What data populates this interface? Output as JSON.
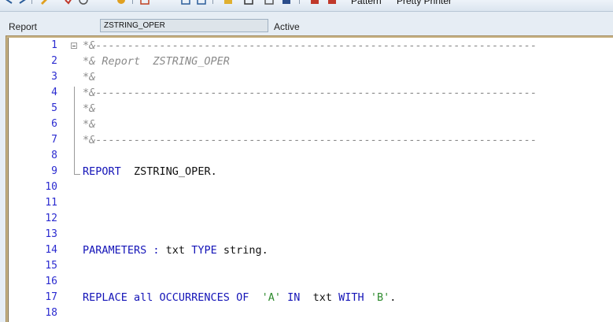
{
  "toolbar": {
    "pattern_label": "Pattern",
    "pretty_printer_label": "Pretty Printer"
  },
  "header": {
    "report_label": "Report",
    "program_name": "ZSTRING_OPER",
    "status": "Active"
  },
  "editor": {
    "lines": [
      {
        "no": "1",
        "tokens": [
          {
            "t": "*&---------------------------------------------------------------------",
            "c": "comment"
          }
        ]
      },
      {
        "no": "2",
        "tokens": [
          {
            "t": "*& Report  ZSTRING_OPER",
            "c": "comment"
          }
        ]
      },
      {
        "no": "3",
        "tokens": [
          {
            "t": "*&",
            "c": "comment"
          }
        ]
      },
      {
        "no": "4",
        "tokens": [
          {
            "t": "*&---------------------------------------------------------------------",
            "c": "comment"
          }
        ]
      },
      {
        "no": "5",
        "tokens": [
          {
            "t": "*&",
            "c": "comment"
          }
        ]
      },
      {
        "no": "6",
        "tokens": [
          {
            "t": "*&",
            "c": "comment"
          }
        ]
      },
      {
        "no": "7",
        "tokens": [
          {
            "t": "*&---------------------------------------------------------------------",
            "c": "comment"
          }
        ]
      },
      {
        "no": "8",
        "tokens": []
      },
      {
        "no": "9",
        "tokens": [
          {
            "t": "REPORT",
            "c": "kw"
          },
          {
            "t": "  ZSTRING_OPER.",
            "c": "plain"
          }
        ]
      },
      {
        "no": "10",
        "tokens": []
      },
      {
        "no": "11",
        "tokens": []
      },
      {
        "no": "12",
        "tokens": []
      },
      {
        "no": "13",
        "tokens": []
      },
      {
        "no": "14",
        "tokens": [
          {
            "t": "PARAMETERS :",
            "c": "kw"
          },
          {
            "t": " txt ",
            "c": "plain"
          },
          {
            "t": "TYPE",
            "c": "kw"
          },
          {
            "t": " string.",
            "c": "plain"
          }
        ]
      },
      {
        "no": "15",
        "tokens": []
      },
      {
        "no": "16",
        "tokens": []
      },
      {
        "no": "17",
        "tokens": [
          {
            "t": "REPLACE all OCCURRENCES OF",
            "c": "kw"
          },
          {
            "t": "  ",
            "c": "plain"
          },
          {
            "t": "'A'",
            "c": "str"
          },
          {
            "t": " ",
            "c": "plain"
          },
          {
            "t": "IN",
            "c": "kw"
          },
          {
            "t": "  txt ",
            "c": "plain"
          },
          {
            "t": "WITH",
            "c": "kw"
          },
          {
            "t": " ",
            "c": "plain"
          },
          {
            "t": "'B'",
            "c": "str"
          },
          {
            "t": ".",
            "c": "plain"
          }
        ]
      },
      {
        "no": "18",
        "tokens": []
      }
    ]
  }
}
